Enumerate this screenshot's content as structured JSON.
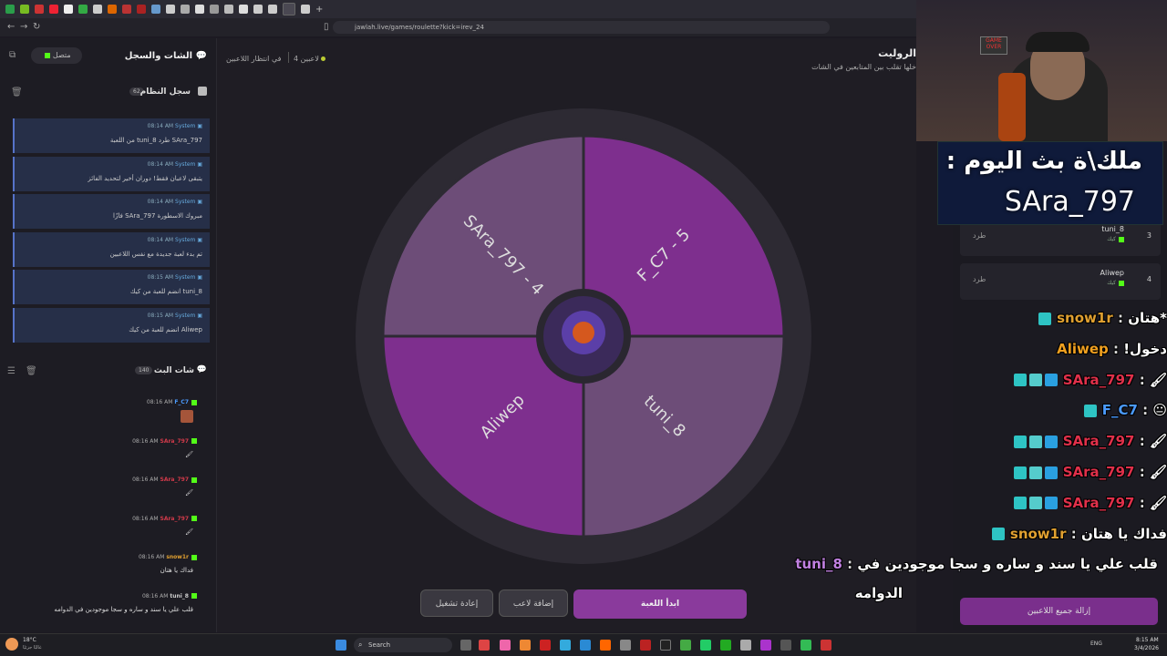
{
  "browser": {
    "url": "jawlah.live/games/roulette?kick=irev_24"
  },
  "left_panel": {
    "title": "الشات والسجل",
    "status": "متصل",
    "system_log_title": "سجل النظام",
    "system_log_count": "62",
    "system_messages": [
      {
        "sender": "System",
        "time": "08:14 AM",
        "text": "SAra_797 طرد tuni_8 من اللعبة"
      },
      {
        "sender": "System",
        "time": "08:14 AM",
        "text": "يتبقى لاعبان فقط! دوران أخير لتحديد الفائز"
      },
      {
        "sender": "System",
        "time": "08:14 AM",
        "text": "مبروك الاسطورة SAra_797 فازًا"
      },
      {
        "sender": "System",
        "time": "08:14 AM",
        "text": "تم بدء لعبة جديدة مع نفس اللاعبين"
      },
      {
        "sender": "System",
        "time": "08:15 AM",
        "text": "tuni_8 انضم للعبة من كيك"
      },
      {
        "sender": "System",
        "time": "08:15 AM",
        "text": "Aliwep انضم للعبة من كيك"
      }
    ],
    "stream_chat_title": "شات البث",
    "stream_chat_count": "140",
    "chat_messages": [
      {
        "user": "F_C7",
        "time": "08:16 AM",
        "text": "",
        "color": "#4b9bff",
        "emote": true
      },
      {
        "user": "SAra_797",
        "time": "08:16 AM",
        "text": "🖌",
        "color": "#d23a4a",
        "emote": false
      },
      {
        "user": "SAra_797",
        "time": "08:16 AM",
        "text": "🖌",
        "color": "#d23a4a",
        "emote": false
      },
      {
        "user": "SAra_797",
        "time": "08:16 AM",
        "text": "🖌",
        "color": "#d23a4a",
        "emote": false
      },
      {
        "user": "snow1r",
        "time": "08:16 AM",
        "text": "فداك يا هتان",
        "color": "#e0a030",
        "emote": false
      },
      {
        "user": "tuni_8",
        "time": "08:16 AM",
        "text": "قلب علي يا سند و ساره و سجا موجودين في الدوامه",
        "color": "#ccc",
        "emote": false
      }
    ]
  },
  "main": {
    "title": "الروليت",
    "subtitle": "خلها تقلب بين المتابعين في الشات",
    "waiting_label": "في انتظار اللاعبين",
    "players_count": "4 لاعبين",
    "wheel_segments": [
      {
        "label": "F_C7 - 5",
        "color": "#7e2f8e"
      },
      {
        "label": "tuni_8",
        "color": "#6d4d78"
      },
      {
        "label": "Aliwep",
        "color": "#7e2f8e"
      },
      {
        "label": "SAra_797 - 4",
        "color": "#6d4d78"
      }
    ],
    "start_button": "ابدأ اللعبة",
    "add_player_button": "إضافة لاعب",
    "restart_button": "إعادة تشغيل"
  },
  "overlay": {
    "king_line1": "ملك\\ة بث اليوم :",
    "king_line2": "SAra_797",
    "overlay_chat": [
      {
        "user": "snow1r",
        "text": "*هتان",
        "color": "#e0a030",
        "icons": [
          "#2ec4c4"
        ]
      },
      {
        "user": "Aliwep",
        "text": "دخول!",
        "color": "#f0a020",
        "icons": []
      },
      {
        "user": "SAra_797",
        "text": "🖌",
        "color": "#e0304a",
        "icons": [
          "#2aa0e0",
          "#5cc",
          "#2ec4c4"
        ]
      },
      {
        "user": "F_C7",
        "text": "😐",
        "color": "#4b9bff",
        "icons": [
          "#2ec4c4"
        ]
      },
      {
        "user": "SAra_797",
        "text": "🖌",
        "color": "#e0304a",
        "icons": [
          "#2aa0e0",
          "#5cc",
          "#2ec4c4"
        ]
      },
      {
        "user": "SAra_797",
        "text": "🖌",
        "color": "#e0304a",
        "icons": [
          "#2aa0e0",
          "#5cc",
          "#2ec4c4"
        ]
      },
      {
        "user": "SAra_797",
        "text": "🖌",
        "color": "#e0304a",
        "icons": [
          "#2aa0e0",
          "#5cc",
          "#2ec4c4"
        ]
      },
      {
        "user": "snow1r",
        "text": "فداك يا هتان",
        "color": "#e0a030",
        "icons": [
          "#2ec4c4"
        ]
      },
      {
        "user": "tuni_8",
        "text": "قلب علي يا سند و ساره و سجا موجودين في",
        "color": "#c080e0",
        "icons": []
      }
    ],
    "overlay_wrap": "الدوامه"
  },
  "right_panel": {
    "players": [
      {
        "num": "3",
        "name": "tuni_8",
        "source": "كيك",
        "kick": "طرد"
      },
      {
        "num": "4",
        "name": "Aliwep",
        "source": "كيك",
        "kick": "طرد"
      }
    ],
    "remove_all_button": "إزالة جميع اللاعبين"
  },
  "taskbar": {
    "weather_temp": "18°C",
    "weather_label": "غالبًا جزئيًا",
    "search_placeholder": "Search",
    "lang": "ENG",
    "time": "8:15 AM",
    "date": "3/4/2026"
  }
}
